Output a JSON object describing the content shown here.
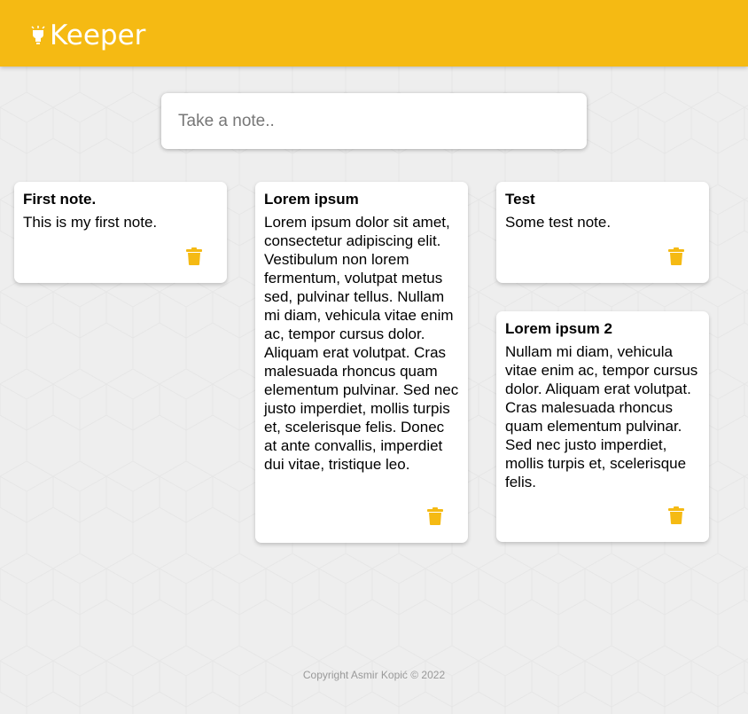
{
  "header": {
    "title": "Keeper"
  },
  "create": {
    "placeholder": "Take a note.."
  },
  "notes": [
    {
      "title": "First note.",
      "content": "This is my first note."
    },
    {
      "title": "Lorem ipsum",
      "content": "Lorem ipsum dolor sit amet, consectetur adipiscing elit. Vestibulum non lorem fermentum, volutpat metus sed, pulvinar tellus. Nullam mi diam, vehicula vitae enim ac, tempor cursus dolor. Aliquam erat volutpat. Cras malesuada rhoncus quam elementum pulvinar. Sed nec justo imperdiet, mollis turpis et, scelerisque felis. Donec at ante convallis, imperdiet dui vitae, tristique leo."
    },
    {
      "title": "Test",
      "content": "Some test note."
    },
    {
      "title": "Lorem ipsum 2",
      "content": "Nullam mi diam, vehicula vitae enim ac, tempor cursus dolor. Aliquam erat volutpat. Cras malesuada rhoncus quam elementum pulvinar. Sed nec justo imperdiet, mollis turpis et, scelerisque felis."
    }
  ],
  "footer": {
    "text": "Copyright Asmir Kopić © 2022"
  },
  "colors": {
    "accent": "#f5ba13",
    "background": "#eeeeee",
    "card": "#ffffff"
  },
  "icons": {
    "brand": "lightbulb-icon",
    "delete": "trash-icon"
  }
}
